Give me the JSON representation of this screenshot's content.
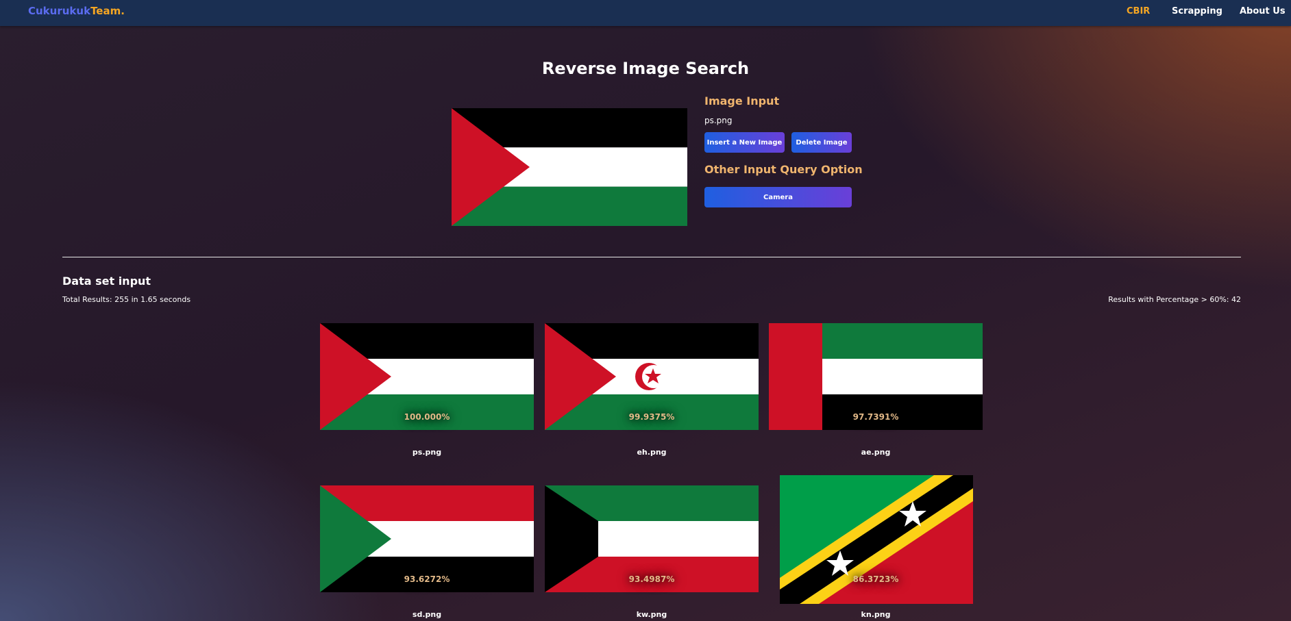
{
  "navbar": {
    "brand_part1": "Cukurukuk",
    "brand_part2": "Team.",
    "links": [
      "CBIR",
      "Scrapping",
      "About Us"
    ]
  },
  "page_title": "Reverse Image Search",
  "query": {
    "image_input_label": "Image Input",
    "filename": "ps.png",
    "insert_button": "Insert a New Image",
    "delete_button": "Delete Image",
    "other_option_label": "Other Input Query Option",
    "camera_button": "Camera"
  },
  "dataset": {
    "title": "Data set input",
    "total_results": "Total Results: 255 in 1.65 seconds",
    "results_over": "Results with Percentage > 60%: 42"
  },
  "results": [
    {
      "name": "ps.png",
      "percent": "100.000%",
      "icon": "palestine-flag"
    },
    {
      "name": "eh.png",
      "percent": "99.9375%",
      "icon": "western-sahara-flag"
    },
    {
      "name": "ae.png",
      "percent": "97.7391%",
      "icon": "uae-flag"
    },
    {
      "name": "sd.png",
      "percent": "93.6272%",
      "icon": "sudan-flag"
    },
    {
      "name": "kw.png",
      "percent": "93.4987%",
      "icon": "kuwait-flag"
    },
    {
      "name": "kn.png",
      "percent": "86.3723%",
      "icon": "saint-kitts-flag"
    }
  ],
  "colors": {
    "navbar": "#1a2f52",
    "accent_orange": "#f5a623",
    "brand_blue": "#5b6cf0",
    "button_start": "#1f5fe0",
    "button_end": "#6a3fd8"
  }
}
